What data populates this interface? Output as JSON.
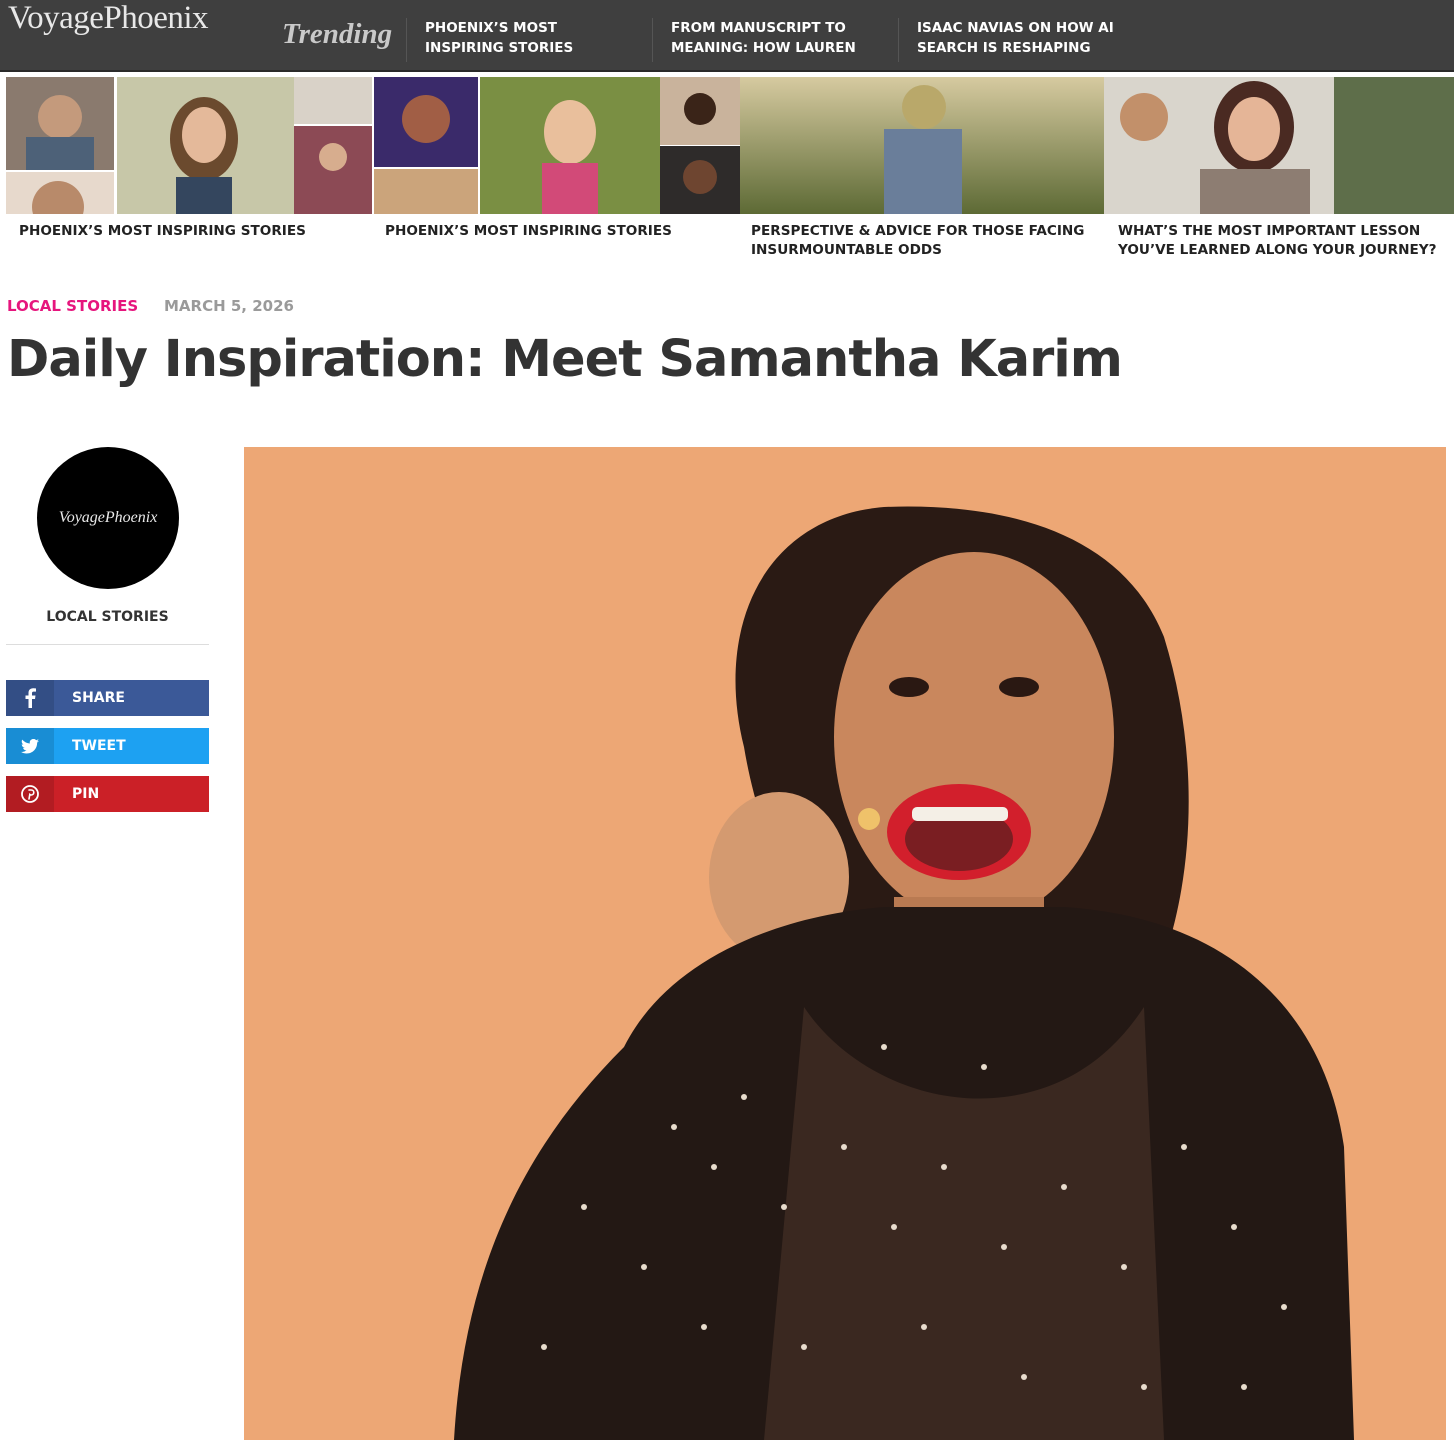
{
  "site": {
    "logo": "VoyagePhoenix"
  },
  "topbar": {
    "trending_label": "Trending",
    "items": [
      {
        "label": "PHOENIX’S MOST INSPIRING STORIES"
      },
      {
        "label": "FROM MANUSCRIPT TO MEANING: HOW LAUREN"
      },
      {
        "label": "ISAAC NAVIAS ON HOW AI SEARCH IS RESHAPING"
      }
    ]
  },
  "featured": [
    {
      "label": "PHOENIX’S MOST INSPIRING STORIES"
    },
    {
      "label": "PHOENIX’S MOST INSPIRING STORIES"
    },
    {
      "label": "PERSPECTIVE & ADVICE FOR THOSE FACING INSURMOUNTABLE ODDS"
    },
    {
      "label": "WHAT’S THE MOST IMPORTANT LESSON YOU’VE LEARNED ALONG YOUR JOURNEY?"
    }
  ],
  "article": {
    "category": "LOCAL STORIES",
    "date": "MARCH 5, 2026",
    "title": "Daily Inspiration: Meet Samantha Karim"
  },
  "sidebar": {
    "avatar_text": "VoyagePhoenix",
    "author": "LOCAL STORIES",
    "share": [
      {
        "label": "SHARE",
        "icon": "facebook-icon",
        "color": "#3b5998"
      },
      {
        "label": "TWEET",
        "icon": "twitter-icon",
        "color": "#1da1f2"
      },
      {
        "label": "PIN",
        "icon": "pinterest-icon",
        "color": "#cb2027"
      }
    ]
  },
  "colors": {
    "accent": "#e6157d",
    "topbar": "#3f3f3f",
    "hero_bg": "#eca676"
  }
}
